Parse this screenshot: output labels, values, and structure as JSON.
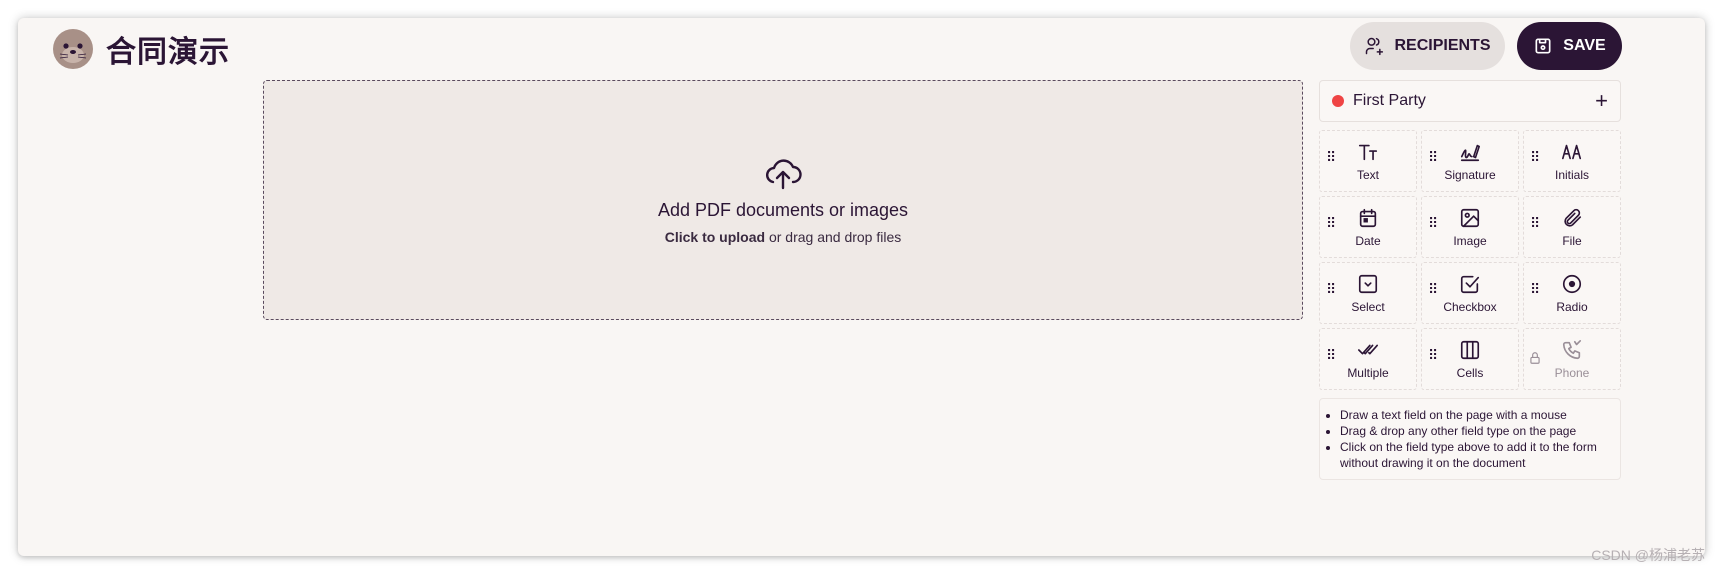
{
  "app": {
    "title": "合同演示"
  },
  "header": {
    "recipients_label": "RECIPIENTS",
    "save_label": "SAVE"
  },
  "dropzone": {
    "title": "Add PDF documents or images",
    "sub_bold": "Click to upload",
    "sub_rest": " or drag and drop files"
  },
  "party": {
    "name": "First Party",
    "color": "#ef4444",
    "add_symbol": "+"
  },
  "fields": [
    {
      "label": "Text",
      "icon": "text-icon"
    },
    {
      "label": "Signature",
      "icon": "signature-icon"
    },
    {
      "label": "Initials",
      "icon": "initials-icon"
    },
    {
      "label": "Date",
      "icon": "calendar-icon"
    },
    {
      "label": "Image",
      "icon": "image-icon"
    },
    {
      "label": "File",
      "icon": "paperclip-icon"
    },
    {
      "label": "Select",
      "icon": "select-icon"
    },
    {
      "label": "Checkbox",
      "icon": "checkbox-icon"
    },
    {
      "label": "Radio",
      "icon": "radio-icon"
    },
    {
      "label": "Multiple",
      "icon": "multiple-check-icon"
    },
    {
      "label": "Cells",
      "icon": "cells-icon"
    },
    {
      "label": "Phone",
      "icon": "phone-icon",
      "locked": true
    }
  ],
  "help": {
    "items": [
      "Draw a text field on the page with a mouse",
      "Drag & drop any other field type on the page",
      "Click on the field type above to add it to the form without drawing it on the document"
    ]
  },
  "watermark": "CSDN @杨浦老苏",
  "colors": {
    "brand": "#2b1535",
    "panel": "#efe9e6",
    "accent_dot": "#ef4444"
  }
}
